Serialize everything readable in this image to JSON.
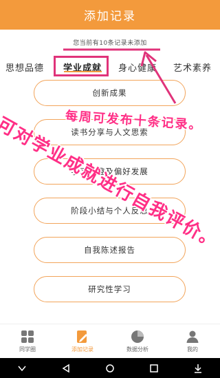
{
  "header": {
    "title": "添加记录"
  },
  "notice": {
    "text": "您当前有10条记录未添加"
  },
  "tabs": [
    {
      "label": "思想品德"
    },
    {
      "label": "学业成就"
    },
    {
      "label": "身心健康"
    },
    {
      "label": "艺术素养"
    }
  ],
  "items": [
    {
      "label": "创新成果"
    },
    {
      "label": "读书分享与人文思索"
    },
    {
      "label": "学习兴趣及偏好发展"
    },
    {
      "label": "阶段小结与个人反思"
    },
    {
      "label": "自我陈述报告"
    },
    {
      "label": "研究性学习"
    }
  ],
  "annotations": {
    "weekly_limit": "每周可发布十条记录。",
    "self_eval": "可对学业成就进行自我评价。"
  },
  "bottom_nav": [
    {
      "label": "同学圈",
      "icon": "grid-icon"
    },
    {
      "label": "添加记录",
      "icon": "edit-record-icon",
      "active": true
    },
    {
      "label": "数据分析",
      "icon": "pie-chart-icon"
    },
    {
      "label": "我的",
      "icon": "user-icon"
    }
  ],
  "colors": {
    "accent": "#f39a3c",
    "annotation": "#e0337a"
  }
}
